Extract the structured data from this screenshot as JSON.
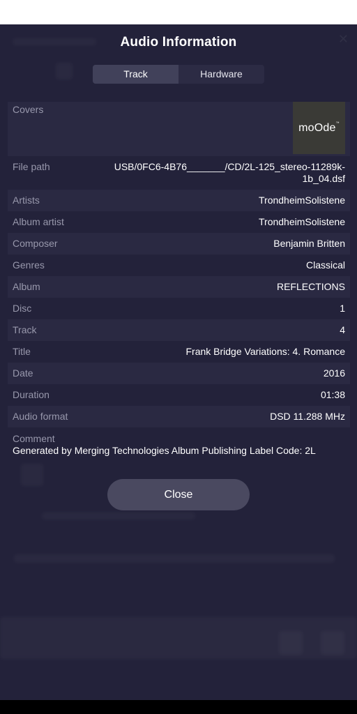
{
  "dialog": {
    "title": "Audio Information",
    "close_label": "Close"
  },
  "tabs": [
    {
      "label": "Track",
      "active": true
    },
    {
      "label": "Hardware",
      "active": false
    }
  ],
  "cover": {
    "label": "Covers",
    "logo_text": "moOde",
    "logo_mark": "™"
  },
  "fields": {
    "file_path": {
      "label": "File path",
      "value": "USB/0FC6-4B76_______/CD/2L-125_stereo-11289k-1b_04.dsf"
    },
    "artists": {
      "label": "Artists",
      "value": "TrondheimSolistene"
    },
    "album_artist": {
      "label": "Album artist",
      "value": "TrondheimSolistene"
    },
    "composer": {
      "label": "Composer",
      "value": "Benjamin Britten"
    },
    "genres": {
      "label": "Genres",
      "value": "Classical"
    },
    "album": {
      "label": "Album",
      "value": "REFLECTIONS"
    },
    "disc": {
      "label": "Disc",
      "value": "1"
    },
    "track": {
      "label": "Track",
      "value": "4"
    },
    "title": {
      "label": "Title",
      "value": "Frank Bridge Variations: 4. Romance"
    },
    "date": {
      "label": "Date",
      "value": "2016"
    },
    "duration": {
      "label": "Duration",
      "value": "01:38"
    },
    "audio_format": {
      "label": "Audio format",
      "value": "DSD 11.288 MHz"
    },
    "comment": {
      "label": "Comment",
      "value": "Generated by Merging Technologies Album Publishing Label Code: 2L"
    }
  },
  "colors": {
    "background": "#23223a",
    "row_alt": "#2a2942",
    "label": "#9898ac",
    "button": "#4a4960"
  }
}
